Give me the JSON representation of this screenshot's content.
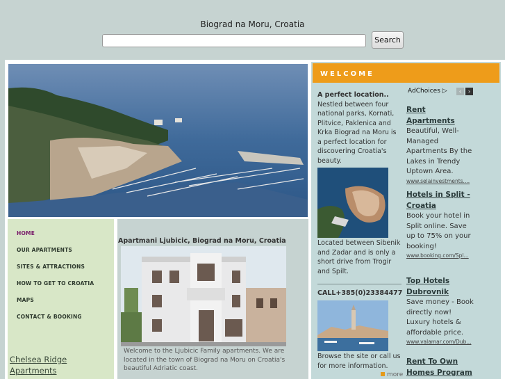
{
  "header": {
    "title": "Biograd na Moru, Croatia",
    "search_value": "",
    "search_button": "Search"
  },
  "nav": {
    "items": [
      {
        "label": "HOME"
      },
      {
        "label": "OUR APARTMENTS"
      },
      {
        "label": "SITES & ATTRACTIONS"
      },
      {
        "label": "HOW TO GET TO CROATIA"
      },
      {
        "label": "MAPS"
      },
      {
        "label": "CONTACT & BOOKING"
      }
    ],
    "sidebar_link": "Chelsea Ridge Apartments"
  },
  "main": {
    "title": "Apartmani Ljubicic, Biograd na Moru, Croatia",
    "intro": "Welcome to the Ljubicic Family apartments. We are located in the town of Biograd na Moru on Croatia's beautiful Adriatic coast."
  },
  "welcome": {
    "heading": "WELCOME",
    "info_title": "A perfect location..",
    "info_text": "Nestled between four national parks, Kornati, Plitvice, Paklenica and Krka Biograd na Moru is a perfect location for discovering Croatia's beauty.",
    "info_text2": "Located between Sibenik and Zadar and is only a short drive from Trogir and Spilt.",
    "phone": "CALL+385(0)23384477",
    "info_text3": "Browse the site or call us for more information.",
    "more": "more"
  },
  "ads": {
    "adchoices": "AdChoices",
    "prev_icon": "‹",
    "next_icon": "›",
    "items": [
      {
        "title": "Rent Apartments",
        "body": "Beautiful, Well-Managed Apartments By the Lakes in Trendy Uptown Area.",
        "url": "www.selainvestments...."
      },
      {
        "title": "Hotels in Split - Croatia",
        "body": "Book your hotel in Split online. Save up to 75% on your booking!",
        "url": "www.booking.com/Spl..."
      },
      {
        "title": "Top Hotels Dubrovnik",
        "body": "Save money - Book directly now! Luxury hotels & affordable price.",
        "url": "www.valamar.com/Dub..."
      },
      {
        "title": "Rent To Own Homes Program",
        "body": "",
        "url": ""
      }
    ]
  },
  "colors": {
    "welcome_bar": "#ee9c1a",
    "nav_home": "#7a1e6b",
    "left_column": "#d8e7c7",
    "right_column": "#c3d9d9"
  }
}
